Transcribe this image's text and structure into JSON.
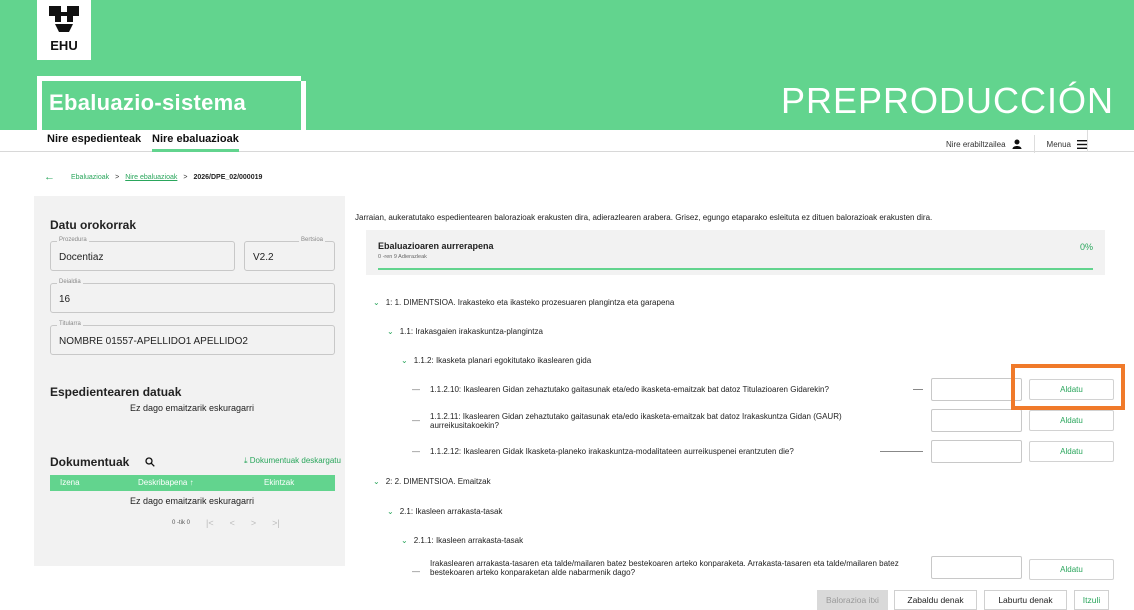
{
  "header": {
    "logo_text": "EHU",
    "app_title": "Ebaluazio-sistema",
    "environment": "PREPRODUCCIÓN"
  },
  "nav": {
    "tabs": [
      {
        "label": "Nire espedienteak",
        "active": false
      },
      {
        "label": "Nire ebaluazioak",
        "active": true
      }
    ],
    "user_label": "Nire erabiltzailea",
    "menu_label": "Menua"
  },
  "breadcrumb": {
    "items": [
      "Ebaluazioak",
      "Nire ebaluazioak",
      "2026/DPE_02/000019"
    ],
    "separator": ">"
  },
  "general": {
    "title": "Datu orokorrak",
    "procedure_label": "Prozedura",
    "procedure_value": "Docentiaz",
    "version_label": "Bertsioa",
    "version_value": "V2.2",
    "call_label": "Deialdia",
    "call_value": "16",
    "holder_label": "Titularra",
    "holder_value": "NOMBRE 01557-APELLIDO1 APELLIDO2"
  },
  "file_data": {
    "title": "Espedientearen datuak",
    "empty": "Ez dago emaitzarik eskuragarri"
  },
  "documents": {
    "title": "Dokumentuak",
    "download_label": "Dokumentuak deskargatu",
    "columns": [
      "Izena",
      "Deskribapena ↑",
      "Ekintzak"
    ],
    "empty": "Ez dago emaitzarik eskuragarri",
    "pager_text": "0 -tik 0"
  },
  "main": {
    "intro": "Jarraian, aukeratutako espedientearen balorazioak erakusten dira, adierazlearen arabera. Grisez, egungo etaparako esleituta ez dituen balorazioak erakusten dira.",
    "progress": {
      "title": "Ebaluazioaren aurrerapena",
      "subtitle": "0 -ren 9 Adierazleak",
      "percent": "0%"
    },
    "tree": {
      "d1": "1: 1. DIMENTSIOA. Irakasteko eta ikasteko prozesuaren plangintza eta garapena",
      "d1_1": "1.1: Irakasgaien irakaskuntza-plangintza",
      "d1_1_2": "1.1.2: Ikasketa planari egokitutako ikaslearen gida",
      "q1": "1.1.2.10: Ikaslearen Gidan zehaztutako gaitasunak eta/edo ikasketa-emaitzak bat datoz Titulazioaren Gidarekin?",
      "q2": "1.1.2.11: Ikaslearen Gidan zehaztutako gaitasunak eta/edo ikasketa-emaitzak bat datoz Irakaskuntza Gidan (GAUR) aurreikusitakoekin?",
      "q3": "1.1.2.12: Ikaslearen Gidak Ikasketa-planeko irakaskuntza-modalitateen aurreikuspenei erantzuten die?",
      "d2": "2: 2. DIMENTSIOA. Emaitzak",
      "d2_1": "2.1: Ikasleen arrakasta-tasak",
      "d2_1_1": "2.1.1: Ikasleen arrakasta-tasak",
      "q4": "Irakaslearen arrakasta-tasaren eta talde/mailaren batez bestekoaren arteko konparaketa. Arrakasta-tasaren eta talde/mailaren batez bestekoaren arteko konparaketan alde nabarmenik dago?"
    },
    "edit_label": "Aldatu"
  },
  "footer": {
    "close_label": "Balorazioa itxi",
    "expand_label": "Zabaldu denak",
    "collapse_label": "Laburtu denak",
    "back_label": "Itzuli"
  }
}
